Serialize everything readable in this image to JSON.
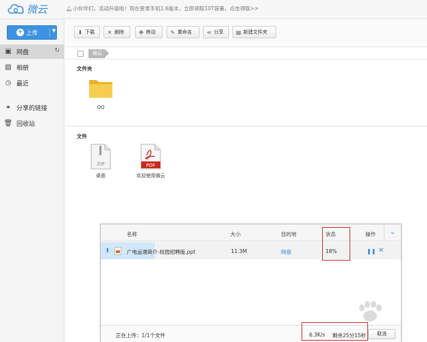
{
  "app": {
    "name": "微云"
  },
  "notice": "小伙伴们，活动升级啦！现在登录手机1.6版本，立即领取10T容量，点击领取>>",
  "sidebar": {
    "upload_label": "上传",
    "items": [
      {
        "label": "网盘",
        "icon": "cloud-disk-icon",
        "active": true
      },
      {
        "label": "相册",
        "icon": "photo-icon"
      },
      {
        "label": "最近",
        "icon": "clock-icon"
      },
      {
        "label": "分享的链接",
        "icon": "link-icon"
      },
      {
        "label": "回收站",
        "icon": "trash-icon"
      }
    ]
  },
  "toolbar": {
    "download": "下载",
    "delete": "删除",
    "move": "移动",
    "rename": "重命名",
    "share": "分享",
    "new_folder": "新建文件夹"
  },
  "breadcrumb": {
    "current": "微云"
  },
  "folders_section": {
    "title": "文件夹",
    "items": [
      {
        "name": "QQ"
      }
    ]
  },
  "files_section": {
    "title": "文件",
    "items": [
      {
        "name": "桌面",
        "badge": "ZIP"
      },
      {
        "name": "欢迎使用微云",
        "badge": "PDF"
      }
    ]
  },
  "upload_dialog": {
    "columns": {
      "name": "名称",
      "size": "大小",
      "dest": "目的地",
      "status": "状态",
      "action": "操作"
    },
    "row": {
      "file_name": "广电运通简介-校园招聘版.ppt",
      "size": "11.3M",
      "dest": "网盘",
      "status": "18%",
      "progress": 0.18
    },
    "footer": {
      "uploading": "正在上传：1/1个文件",
      "speed": "6.3K/s",
      "remaining": "剩余25分15秒",
      "cancel": "取消"
    }
  },
  "colors": {
    "accent": "#3d93e1",
    "highlight": "#c92b2b",
    "folder": "#f3c23d"
  }
}
